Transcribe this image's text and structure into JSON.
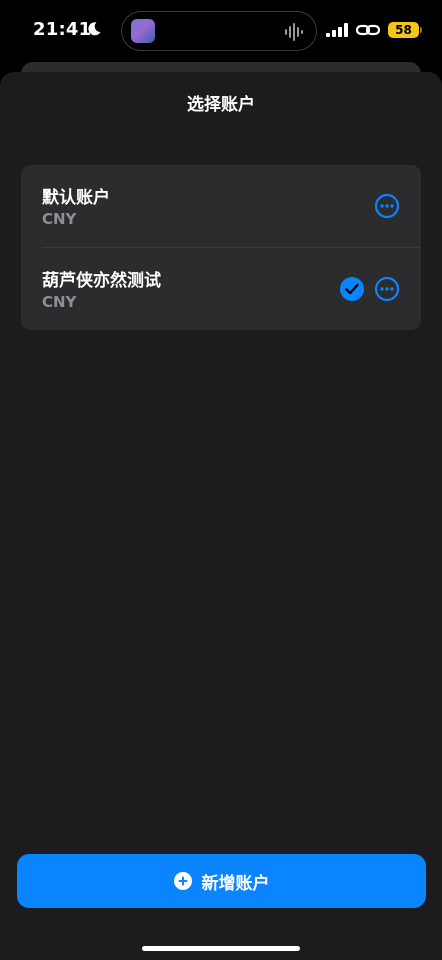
{
  "status": {
    "time": "21:41",
    "battery": "58"
  },
  "sheet": {
    "title": "选择账户"
  },
  "accounts": [
    {
      "name": "默认账户",
      "currency": "CNY",
      "selected": false
    },
    {
      "name": "葫芦侠亦然测试",
      "currency": "CNY",
      "selected": true
    }
  ],
  "actions": {
    "add_label": "新增账户"
  },
  "icons": {
    "moon": "moon-icon",
    "signal": "cellular-signal-icon",
    "link": "personal-hotspot-icon",
    "more": "ellipsis-circle-icon",
    "check": "checkmark-circle-icon",
    "plus": "plus-circle-icon"
  },
  "colors": {
    "accent": "#0a84ff",
    "sheet": "#1c1c1e",
    "card": "#2c2c2e",
    "battery": "#f5c518"
  }
}
